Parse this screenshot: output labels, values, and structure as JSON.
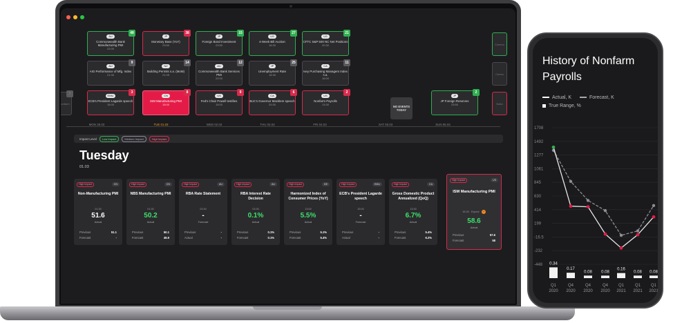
{
  "calendar": {
    "row1": [
      {
        "country": "AU",
        "title": "Commonwealth Bank Manufacturing PMI",
        "time": "22:00",
        "count": "48",
        "impact": "low"
      },
      {
        "country": "JP",
        "title": "Monetary Base (YoY)",
        "time": "23:50",
        "count": "38",
        "impact": "high"
      },
      {
        "country": "JP",
        "title": "Foreign Bond Investment",
        "time": "23:50",
        "count": "15",
        "impact": "low"
      },
      {
        "country": "US",
        "title": "4-Week Bill Auction",
        "time": "16:30",
        "count": "27",
        "impact": "low"
      },
      {
        "country": "US",
        "title": "CFTC S&P 500 NC Net Positions",
        "time": "20:30",
        "count": "21",
        "impact": "low"
      }
    ],
    "row2": [
      {
        "country": "AU",
        "title": "AIG Performance of Mfg. Index",
        "time": "21:30",
        "count": "9",
        "impact": "none"
      },
      {
        "country": "NZ",
        "title": "Building Permits s.a. (MoM)",
        "time": "21:45",
        "count": "14",
        "impact": "none"
      },
      {
        "country": "AU",
        "title": "Commonwealth Bank Services PMI",
        "time": "22:00",
        "count": "12",
        "impact": "none"
      },
      {
        "country": "JP",
        "title": "Unemployment Rate",
        "time": "16:30",
        "count": "25",
        "impact": "none"
      },
      {
        "country": "CA",
        "title": "Ivey Purchasing Managers Index s.a.",
        "time": "16:00",
        "count": "11",
        "impact": "none"
      }
    ],
    "row3": [
      {
        "country": "EMU",
        "title": "ECB's President Lagarde speech",
        "time": "15:00",
        "count": "3",
        "impact": "high"
      },
      {
        "country": "CN",
        "title": "ISM Manufacturing PMI",
        "time": "15:00",
        "count": "8",
        "impact": "active"
      },
      {
        "country": "US",
        "title": "Fed's Chair Powell testifies",
        "time": "15:00",
        "count": "9",
        "impact": "high"
      },
      {
        "country": "CA",
        "title": "BoC's Governor Macklem speech",
        "time": "20:30",
        "count": "6",
        "impact": "high"
      },
      {
        "country": "US",
        "title": "Nonfarm Payrolls",
        "time": "13:30",
        "count": "2",
        "impact": "high"
      },
      {
        "country": "JP",
        "title": "JP Foreign Reserves",
        "time": "23:50",
        "count": "2",
        "impact": "low"
      }
    ],
    "side_left": [
      "Nonfarm",
      "ISM Manu"
    ],
    "side_right": [
      "Commo",
      "Comm",
      "Natio"
    ],
    "side_left_count": "5",
    "no_events": "NO EVENTS TODAY",
    "days": [
      "MON 28.03",
      "TUE 01.03",
      "WED 02.03",
      "THU 03.03",
      "FRI 04.03",
      "SAT 05.03",
      "SUN 06.03"
    ]
  },
  "impact_bar": {
    "label": "Impact Level",
    "low": "Low Impact",
    "medium": "Medium Impact",
    "high": "High Impact"
  },
  "day": {
    "name": "Tuesday",
    "date": "01.03"
  },
  "cards": [
    {
      "impact": "High Impact",
      "country": "CN",
      "title": "Non-Manufacturing PMI",
      "time": "01:30",
      "value": "51.6",
      "value_label": "Actual",
      "rows": [
        [
          "Previous",
          "51.1"
        ],
        [
          "Forecast",
          "-"
        ]
      ],
      "positive": false
    },
    {
      "impact": "High Impact",
      "country": "CN",
      "title": "NBS Manufacturing PMI",
      "time": "01:30",
      "value": "50.2",
      "value_label": "Actual",
      "rows": [
        [
          "Previous",
          "50.1"
        ],
        [
          "Forecast",
          "49.9"
        ]
      ],
      "positive": true
    },
    {
      "impact": "High Impact",
      "country": "AU",
      "title": "RBA Rate Statement",
      "time": "03:30",
      "value": "-",
      "value_label": "Forecast",
      "rows": [
        [
          "Previous",
          "-"
        ],
        [
          "Actual",
          "-"
        ]
      ],
      "positive": false
    },
    {
      "impact": "High Impact",
      "country": "AU",
      "title": "RBA Interest Rate Decision",
      "time": "03:30",
      "value": "0.1%",
      "value_label": "Actual",
      "rows": [
        [
          "Previous",
          "0.1%"
        ],
        [
          "Forecast",
          "0.1%"
        ]
      ],
      "positive": true
    },
    {
      "impact": "High Impact",
      "country": "DE",
      "title": "Harmonized Index of Consumer Prices (YoY)",
      "time": "13:00",
      "value": "5.5%",
      "value_label": "Actual",
      "rows": [
        [
          "Previous",
          "5.1%"
        ],
        [
          "Forecast",
          "5.4%"
        ]
      ],
      "positive": true
    },
    {
      "impact": "High Impact",
      "country": "EMU",
      "title": "ECB's President Lagarde speech",
      "time": "15:00",
      "value": "-",
      "value_label": "Forecast",
      "rows": [
        [
          "Previous",
          "-"
        ],
        [
          "Actual",
          "-"
        ]
      ],
      "positive": false
    },
    {
      "impact": "High Impact",
      "country": "CA",
      "title": "Gross Domestic Product Annualized (QoQ)",
      "time": "13:30",
      "value": "6.7%",
      "value_label": "Actual",
      "rows": [
        [
          "Previous",
          "5.4%"
        ],
        [
          "Forecast",
          "6.2%"
        ]
      ],
      "positive": true
    }
  ],
  "featured": {
    "impact": "High Impact",
    "country": "US",
    "title": "ISM Manufacturing PMI",
    "time": "15:00",
    "expected": "Expect",
    "value": "58.6",
    "value_label": "Actual",
    "rows": [
      [
        "Previous",
        "57.6"
      ],
      [
        "Forecast",
        "58"
      ]
    ]
  },
  "phone": {
    "title": "History of Nonfarm Payrolls",
    "legend_actual": "Actual, K",
    "legend_forecast": "Forecast, K",
    "legend_range": "True Range, %"
  },
  "colors": {
    "red": "#d92a4c",
    "green": "#2fb050",
    "accent": "#f0a020"
  },
  "chart_data": {
    "type": "line",
    "title": "History of Nonfarm Payrolls",
    "x": [
      "Q1 2020",
      "Q4 2020",
      "Q4 2020",
      "Q4 2020",
      "Q1 2021",
      "Q1 2021",
      "Q1 2021"
    ],
    "series": [
      {
        "name": "Actual, K",
        "values": [
          1400,
          470,
          460,
          30,
          -190,
          20,
          300
        ]
      },
      {
        "name": "Forecast, K",
        "values": [
          1350,
          860,
          560,
          400,
          10,
          80,
          480
        ]
      }
    ],
    "range_series": {
      "name": "True Range, %",
      "values": [
        0.34,
        0.17,
        0.08,
        0.08,
        0.16,
        0.08,
        0.08
      ]
    },
    "y_ticks": [
      "1708",
      "1492",
      "1277",
      "1061",
      "845",
      "630",
      "414",
      "199",
      "-16.5",
      "-232",
      "-448"
    ],
    "ylim": [
      -448,
      1708
    ]
  }
}
